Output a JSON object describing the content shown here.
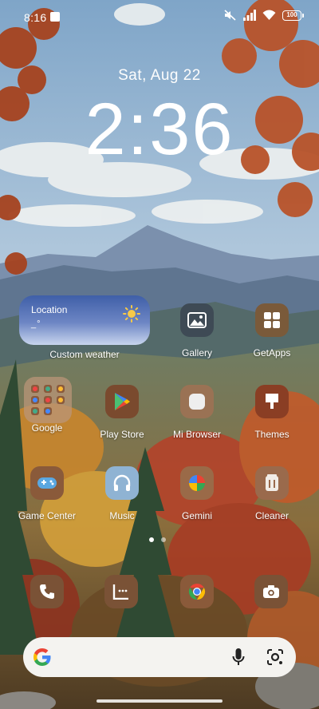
{
  "status_bar": {
    "time": "8:16",
    "battery": "100"
  },
  "lock": {
    "date": "Sat, Aug 22",
    "time": "2:36"
  },
  "weather_widget": {
    "location": "Location",
    "temperature": "_°",
    "label": "Custom weather",
    "icon": "sun-icon"
  },
  "apps": [
    {
      "label": "Gallery",
      "icon": "gallery-icon"
    },
    {
      "label": "GetApps",
      "icon": "getapps-icon"
    },
    {
      "label": "Google",
      "icon": "folder-icon"
    },
    {
      "label": "Play Store",
      "icon": "play-store-icon"
    },
    {
      "label": "Mi Browser",
      "icon": "browser-icon"
    },
    {
      "label": "Themes",
      "icon": "themes-icon"
    },
    {
      "label": "Game Center",
      "icon": "game-center-icon"
    },
    {
      "label": "Music",
      "icon": "headphones-icon"
    },
    {
      "label": "Gemini",
      "icon": "gemini-icon"
    },
    {
      "label": "Cleaner",
      "icon": "cleaner-icon"
    }
  ],
  "dock": [
    {
      "icon": "phone-icon"
    },
    {
      "icon": "messages-icon"
    },
    {
      "icon": "chrome-icon"
    },
    {
      "icon": "camera-icon"
    }
  ],
  "pages": {
    "count": 2,
    "current": 1
  },
  "search_bar": {
    "icons": [
      "google-g-icon",
      "microphone-icon",
      "lens-icon"
    ]
  },
  "colors": {
    "icon_tint": "#7a4a2e",
    "search_bar": "#f4f3f0",
    "widget_top": "#3f5fa8"
  }
}
